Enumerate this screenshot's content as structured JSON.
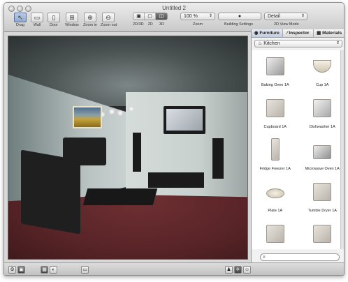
{
  "window": {
    "title": "Untitled 2"
  },
  "toolbar": {
    "tools": [
      {
        "label": "Drag",
        "icon": "arrow-cursor-icon",
        "glyph": "↖",
        "active": true
      },
      {
        "label": "Wall",
        "icon": "wall-icon",
        "glyph": "▭",
        "active": false
      },
      {
        "label": "Door",
        "icon": "door-icon",
        "glyph": "▯",
        "active": false
      },
      {
        "label": "Window",
        "icon": "window-icon",
        "glyph": "⊞",
        "active": false
      },
      {
        "label": "Zoom in",
        "icon": "zoom-in-icon",
        "glyph": "⊕",
        "active": false
      },
      {
        "label": "Zoom out",
        "icon": "zoom-out-icon",
        "glyph": "⊖",
        "active": false
      }
    ],
    "view_mode": {
      "options": [
        "2D/3D",
        "2D",
        "3D"
      ],
      "selected": "3D"
    },
    "zoom": {
      "value": "100 %",
      "label": "Zoom"
    },
    "building_settings": {
      "label": "Building Settings"
    },
    "view_mode_2d": {
      "value": "Detail",
      "label": "2D View Mode"
    }
  },
  "sidebar": {
    "tabs": [
      {
        "label": "Furniture",
        "icon": "furniture-icon",
        "active": true
      },
      {
        "label": "Inspector",
        "icon": "inspector-icon",
        "active": false
      },
      {
        "label": "Materials",
        "icon": "materials-icon",
        "active": false
      }
    ],
    "category": "Kitchen",
    "items": [
      {
        "name": "Baking Oven 1A",
        "icon": "baking-oven-icon"
      },
      {
        "name": "Cup 1A",
        "icon": "cup-icon"
      },
      {
        "name": "Cupboard 1A",
        "icon": "cupboard-icon"
      },
      {
        "name": "Dishwasher 1A",
        "icon": "dishwasher-icon"
      },
      {
        "name": "Fridge Freezer 1A",
        "icon": "fridge-freezer-icon"
      },
      {
        "name": "Microwave Oven 1A",
        "icon": "microwave-oven-icon"
      },
      {
        "name": "Plate 1A",
        "icon": "plate-icon"
      },
      {
        "name": "Tumble Dryer 1A",
        "icon": "tumble-dryer-icon"
      },
      {
        "name": "",
        "icon": "partial-item-icon"
      },
      {
        "name": "",
        "icon": "partial-item-icon"
      }
    ],
    "search": {
      "placeholder": ""
    }
  },
  "statusbar": {
    "buttons": [
      {
        "icon": "gear-icon",
        "glyph": "⚙"
      },
      {
        "icon": "camera-icon",
        "glyph": "▣"
      },
      {
        "icon": "plan-view-icon",
        "glyph": "▦"
      },
      {
        "icon": "orbit-icon",
        "glyph": "◐"
      },
      {
        "icon": "screenshot-icon",
        "glyph": "▭"
      },
      {
        "icon": "walk-mode-icon",
        "glyph": "♟"
      },
      {
        "icon": "fly-mode-icon",
        "glyph": "✈"
      },
      {
        "icon": "person-view-icon",
        "glyph": "☺"
      }
    ]
  }
}
